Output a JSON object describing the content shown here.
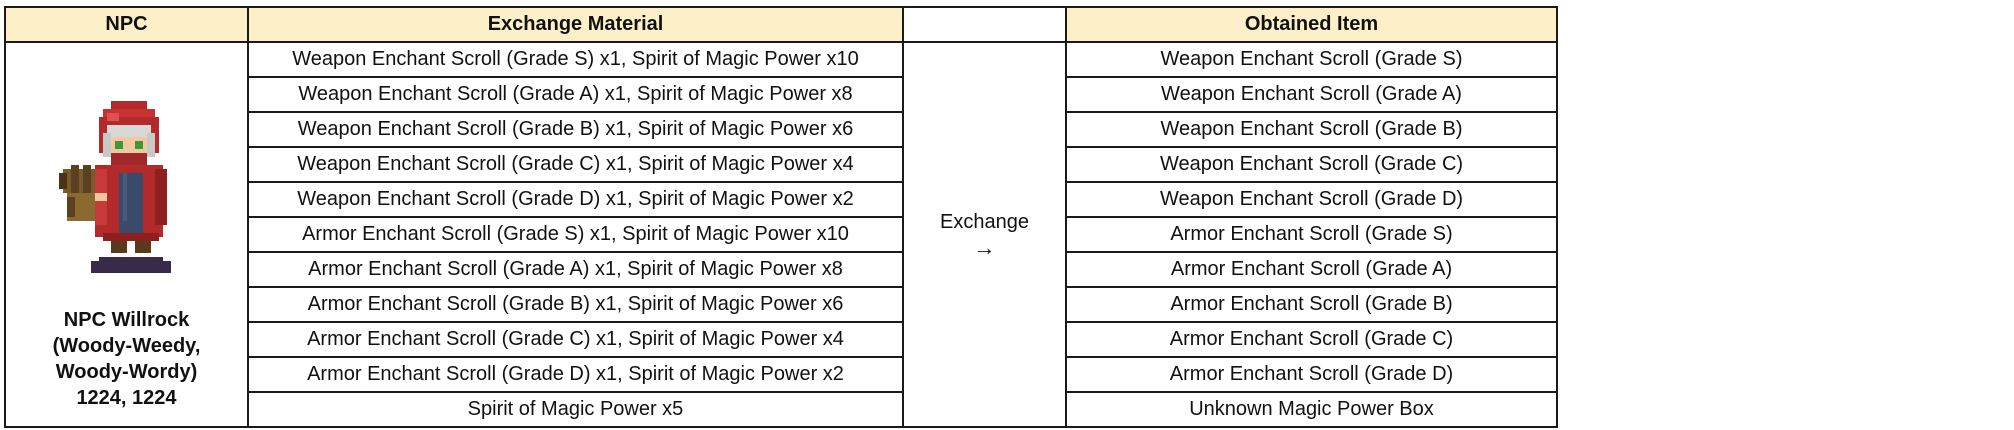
{
  "headers": {
    "npc": "NPC",
    "material": "Exchange Material",
    "obtained": "Obtained Item"
  },
  "npc": {
    "name_lines": [
      "NPC Willrock",
      "(Woody-Weedy,",
      "Woody-Wordy)",
      "1224, 1224"
    ],
    "sprite_icon": "red-hooded-npc-with-cannon"
  },
  "exchange": {
    "label": "Exchange",
    "arrow": "→"
  },
  "rows": [
    {
      "material": "Weapon Enchant Scroll (Grade S) x1, Spirit of Magic Power x10",
      "obtained": "Weapon Enchant Scroll (Grade S)"
    },
    {
      "material": "Weapon Enchant Scroll (Grade A) x1, Spirit of Magic Power x8",
      "obtained": "Weapon Enchant Scroll (Grade A)"
    },
    {
      "material": "Weapon Enchant Scroll (Grade B) x1, Spirit of Magic Power x6",
      "obtained": "Weapon Enchant Scroll (Grade B)"
    },
    {
      "material": "Weapon Enchant Scroll (Grade C) x1, Spirit of Magic Power x4",
      "obtained": "Weapon Enchant Scroll (Grade C)"
    },
    {
      "material": "Weapon Enchant Scroll (Grade D) x1, Spirit of Magic Power x2",
      "obtained": "Weapon Enchant Scroll (Grade D)"
    },
    {
      "material": "Armor Enchant Scroll (Grade S) x1, Spirit of Magic Power x10",
      "obtained": "Armor Enchant Scroll (Grade S)"
    },
    {
      "material": "Armor Enchant Scroll (Grade A) x1, Spirit of Magic Power x8",
      "obtained": "Armor Enchant Scroll (Grade A)"
    },
    {
      "material": "Armor Enchant Scroll (Grade B) x1, Spirit of Magic Power x6",
      "obtained": "Armor Enchant Scroll (Grade B)"
    },
    {
      "material": "Armor Enchant Scroll (Grade C) x1, Spirit of Magic Power x4",
      "obtained": "Armor Enchant Scroll (Grade C)"
    },
    {
      "material": "Armor Enchant Scroll (Grade D) x1, Spirit of Magic Power x2",
      "obtained": "Armor Enchant Scroll (Grade D)"
    },
    {
      "material": "Spirit of Magic Power x5",
      "obtained": "Unknown Magic Power Box"
    }
  ],
  "colors": {
    "header_bg": "#fdf0c8",
    "border": "#1a1a1a"
  }
}
